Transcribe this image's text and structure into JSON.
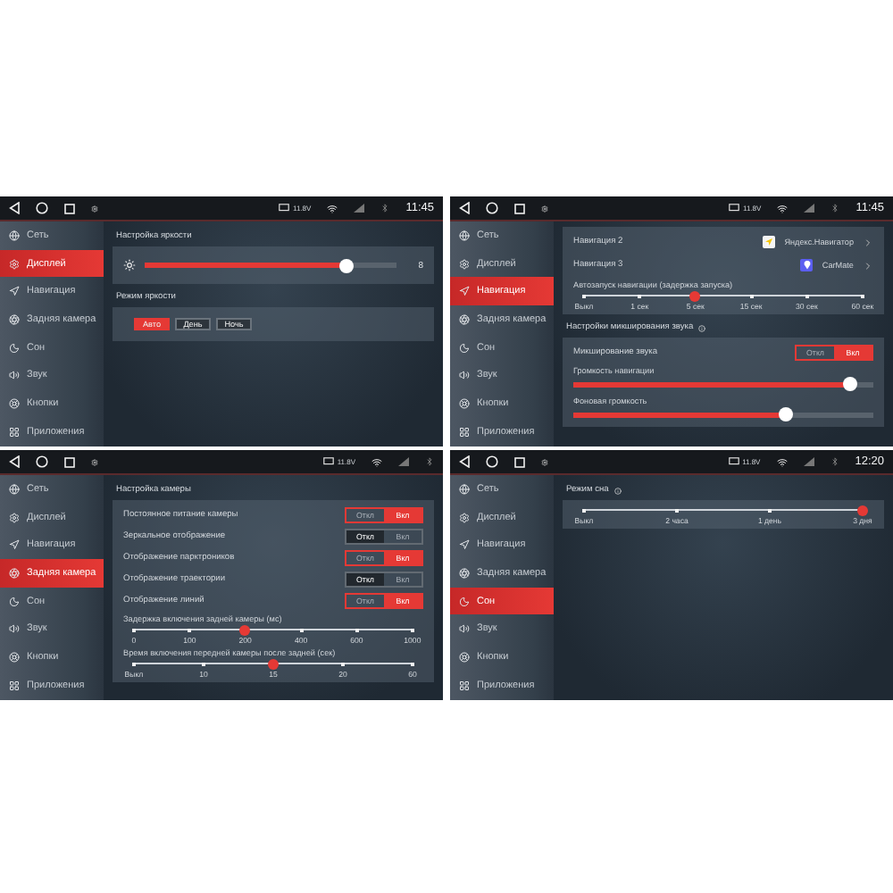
{
  "screens": [
    {
      "status": {
        "voltage": "11.8V",
        "time": "11:45"
      },
      "sidebar": [
        {
          "label": "Сеть",
          "selected": false
        },
        {
          "label": "Дисплей",
          "selected": true
        },
        {
          "label": "Навигация",
          "selected": false
        },
        {
          "label": "Задняя камера",
          "selected": false
        },
        {
          "label": "Сон",
          "selected": false
        },
        {
          "label": "Звук",
          "selected": false
        },
        {
          "label": "Кнопки",
          "selected": false
        },
        {
          "label": "Приложения",
          "selected": false
        }
      ],
      "content": [
        {
          "kind": "heading",
          "text": "Настройка яркости"
        },
        {
          "kind": "panel",
          "items": [
            {
              "kind": "brightness",
              "level": 0.8,
              "reading": "8"
            }
          ]
        },
        {
          "kind": "heading",
          "text": "Режим яркости"
        },
        {
          "kind": "panel",
          "items": [
            {
              "kind": "segmented",
              "options": [
                {
                  "label": "Авто",
                  "selected": true
                },
                {
                  "label": "День",
                  "selected": false
                },
                {
                  "label": "Ночь",
                  "selected": false
                }
              ]
            }
          ]
        }
      ]
    },
    {
      "status": {
        "voltage": "11.8V",
        "time": "11:45"
      },
      "sidebar": [
        {
          "label": "Сеть",
          "selected": false
        },
        {
          "label": "Дисплей",
          "selected": false
        },
        {
          "label": "Навигация",
          "selected": true
        },
        {
          "label": "Задняя камера",
          "selected": false
        },
        {
          "label": "Сон",
          "selected": false
        },
        {
          "label": "Звук",
          "selected": false
        },
        {
          "label": "Кнопки",
          "selected": false
        },
        {
          "label": "Приложения",
          "selected": false
        }
      ],
      "content": [
        {
          "kind": "panel",
          "items": [
            {
              "kind": "link",
              "label": "Навигация 2",
              "value": "Яндекс.Навигатор"
            },
            {
              "kind": "link",
              "label": "Навигация 3",
              "value": "CarMate"
            },
            {
              "kind": "steps",
              "label": "Автозапуск навигации (задержка запуска)",
              "ticks": [
                {
                  "label": "Выкл",
                  "selected": false
                },
                {
                  "label": "1 сек",
                  "selected": false
                },
                {
                  "label": "5 сек",
                  "selected": true
                },
                {
                  "label": "15 сек",
                  "selected": false
                },
                {
                  "label": "30 сек",
                  "selected": false
                },
                {
                  "label": "60 сек",
                  "selected": false
                }
              ]
            }
          ]
        },
        {
          "kind": "heading",
          "text": "Настройки микширования звука",
          "info": true
        },
        {
          "kind": "panel",
          "items": [
            {
              "kind": "toggle",
              "label": "Микширование звука",
              "options": [
                {
                  "label": "Откл",
                  "selected": false
                },
                {
                  "label": "Вкл",
                  "selected": true
                }
              ]
            },
            {
              "kind": "slider",
              "label": "Громкость навигации",
              "level": 0.92
            },
            {
              "kind": "slider",
              "label": "Фоновая громкость",
              "level": 0.71
            }
          ]
        }
      ]
    },
    {
      "status": {
        "voltage": "11.8V"
      },
      "sidebar": [
        {
          "label": "Сеть",
          "selected": false
        },
        {
          "label": "Дисплей",
          "selected": false
        },
        {
          "label": "Навигация",
          "selected": false
        },
        {
          "label": "Задняя камера",
          "selected": true
        },
        {
          "label": "Сон",
          "selected": false
        },
        {
          "label": "Звук",
          "selected": false
        },
        {
          "label": "Кнопки",
          "selected": false
        },
        {
          "label": "Приложения",
          "selected": false
        }
      ],
      "content": [
        {
          "kind": "heading",
          "text": "Настройка камеры"
        },
        {
          "kind": "panel",
          "items": [
            {
              "kind": "toggle",
              "label": "Постоянное питание камеры",
              "options": [
                {
                  "label": "Откл",
                  "selected": false
                },
                {
                  "label": "Вкл",
                  "selected": true
                }
              ]
            },
            {
              "kind": "toggle",
              "label": "Зеркальное отображение",
              "options": [
                {
                  "label": "Откл",
                  "selected": true
                },
                {
                  "label": "Вкл",
                  "selected": false
                }
              ]
            },
            {
              "kind": "toggle",
              "label": "Отображение парктроников",
              "options": [
                {
                  "label": "Откл",
                  "selected": false
                },
                {
                  "label": "Вкл",
                  "selected": true
                }
              ]
            },
            {
              "kind": "toggle",
              "label": "Отображение траектории",
              "options": [
                {
                  "label": "Откл",
                  "selected": true
                },
                {
                  "label": "Вкл",
                  "selected": false
                }
              ]
            },
            {
              "kind": "toggle",
              "label": "Отображение линий",
              "options": [
                {
                  "label": "Откл",
                  "selected": false
                },
                {
                  "label": "Вкл",
                  "selected": true
                }
              ]
            },
            {
              "kind": "steps",
              "label": "Задержка включения задней камеры (мс)",
              "ticks": [
                {
                  "label": "0",
                  "selected": false
                },
                {
                  "label": "100",
                  "selected": false
                },
                {
                  "label": "200",
                  "selected": true
                },
                {
                  "label": "400",
                  "selected": false
                },
                {
                  "label": "600",
                  "selected": false
                },
                {
                  "label": "1000",
                  "selected": false
                }
              ]
            },
            {
              "kind": "steps",
              "label": "Время включения передней камеры после задней (сек)",
              "ticks": [
                {
                  "label": "Выкл",
                  "selected": false
                },
                {
                  "label": "10",
                  "selected": false
                },
                {
                  "label": "15",
                  "selected": true
                },
                {
                  "label": "20",
                  "selected": false
                },
                {
                  "label": "60",
                  "selected": false
                }
              ]
            }
          ]
        }
      ]
    },
    {
      "status": {
        "voltage": "11.8V",
        "time": "12:20"
      },
      "sidebar": [
        {
          "label": "Сеть",
          "selected": false
        },
        {
          "label": "Дисплей",
          "selected": false
        },
        {
          "label": "Навигация",
          "selected": false
        },
        {
          "label": "Задняя камера",
          "selected": false
        },
        {
          "label": "Сон",
          "selected": true
        },
        {
          "label": "Звук",
          "selected": false
        },
        {
          "label": "Кнопки",
          "selected": false
        },
        {
          "label": "Приложения",
          "selected": false
        }
      ],
      "content": [
        {
          "kind": "heading",
          "text": "Режим сна",
          "info": true
        },
        {
          "kind": "panel",
          "items": [
            {
              "kind": "steps",
              "ticks": [
                {
                  "label": "Выкл",
                  "selected": false
                },
                {
                  "label": "2 часа",
                  "selected": false
                },
                {
                  "label": "1 день",
                  "selected": false
                },
                {
                  "label": "3 дня",
                  "selected": true
                }
              ]
            }
          ]
        }
      ]
    }
  ]
}
